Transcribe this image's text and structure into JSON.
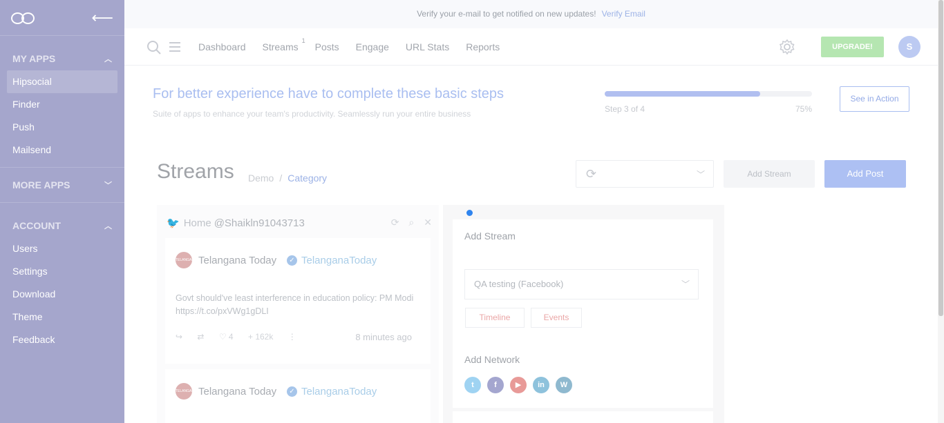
{
  "sidebar": {
    "logo_icon": "infinity-logo-icon",
    "back_icon": "arrow-left-icon",
    "sections": [
      {
        "title": "MY APPS",
        "items": [
          "Hipsocial",
          "Finder",
          "Push",
          "Mailsend"
        ]
      },
      {
        "title": "MORE APPS",
        "items": []
      },
      {
        "title": "ACCOUNT",
        "items": [
          "Users",
          "Settings",
          "Download",
          "Theme",
          "Feedback"
        ]
      }
    ],
    "active_item": "Hipsocial"
  },
  "verify": {
    "text": "Verify your e-mail to get notified on new updates!",
    "link": "Verify Email"
  },
  "nav": {
    "links": [
      "Dashboard",
      "Streams",
      "Posts",
      "Engage",
      "URL Stats",
      "Reports"
    ],
    "streams_badge": "1",
    "upgrade": "UPGRADE!",
    "avatar": "S"
  },
  "steps": {
    "title": "For better experience have to complete these basic steps",
    "subtitle": "Suite of apps to enhance your team's productivity. Seamlessly run your entire business",
    "step_label": "Step 3 of 4",
    "percent_label": "75%",
    "progress": 0.75,
    "cta": "See in Action"
  },
  "streams": {
    "title": "Streams",
    "crumb_1": "Demo",
    "crumb_sep": "/",
    "crumb_2": "Category",
    "add_stream": "Add Stream",
    "add_post": "Add Post"
  },
  "column": {
    "home": "Home",
    "handle": "@Shaikln91043713",
    "tweets": [
      {
        "name": "Telangana Today",
        "handle": "TelanganaToday",
        "avatar_text": "TELANGANA TODAY",
        "text": "Govt should've least interference in education policy: PM Modi https://t.co/pxVWg1gDLI",
        "likes": "4",
        "followers": "162k",
        "time": "8 minutes ago"
      },
      {
        "name": "Telangana Today",
        "handle": "TelanganaToday",
        "avatar_text": "TELANGANA TODAY"
      }
    ]
  },
  "panel": {
    "title": "Add Stream",
    "selected_account": "QA testing (Facebook)",
    "tags": [
      "Timeline",
      "Events"
    ],
    "network_title": "Add Network",
    "networks": [
      {
        "name": "twitter-icon",
        "glyph": "t",
        "color": "#9fd3f2"
      },
      {
        "name": "facebook-icon",
        "glyph": "f",
        "color": "#a4a6cf"
      },
      {
        "name": "youtube-icon",
        "glyph": "▶",
        "color": "#e89a98"
      },
      {
        "name": "linkedin-icon",
        "glyph": "in",
        "color": "#8ec2dc"
      },
      {
        "name": "wordpress-icon",
        "glyph": "W",
        "color": "#8fb9cf"
      }
    ]
  }
}
